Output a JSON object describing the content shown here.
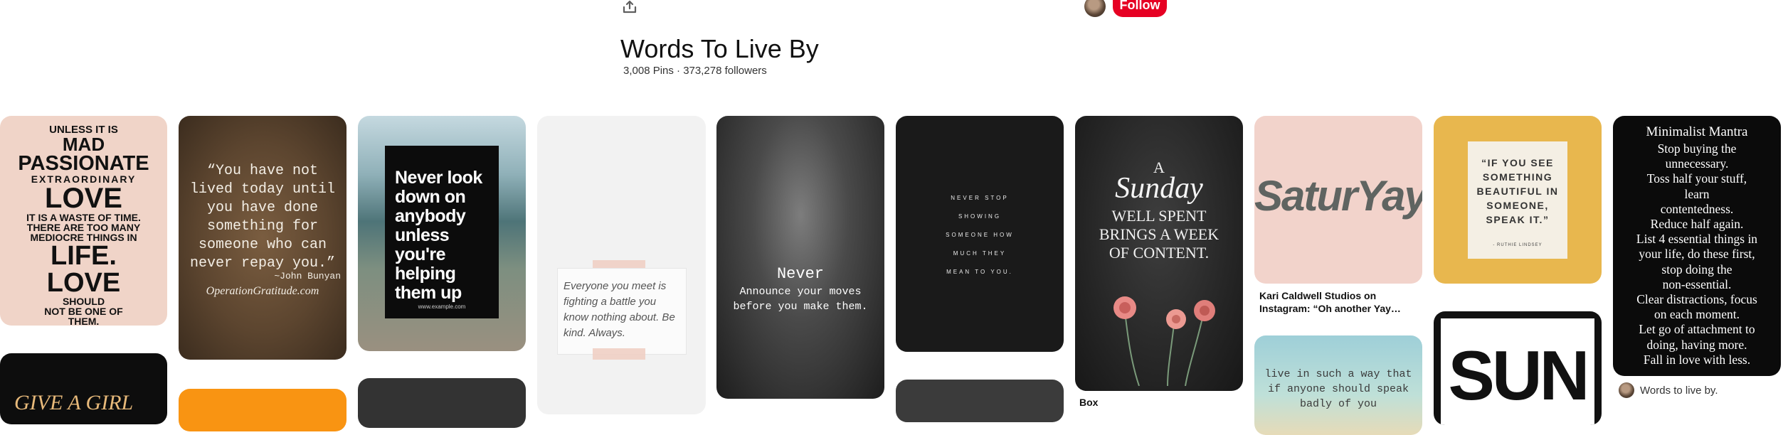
{
  "board": {
    "title": "Words To Live By",
    "stats": "3,008 Pins · 373,278 followers",
    "follow_label": "Follow"
  },
  "colors": {
    "brand": "#e60023"
  },
  "pins": {
    "p1": {
      "lines": [
        "UNLESS IT IS",
        "MAD",
        "PASSIONATE",
        "EXTRAORDINARY",
        "LOVE",
        "IT IS A WASTE OF TIME.",
        "THERE ARE TOO MANY",
        "MEDIOCRE THINGS IN",
        "LIFE.",
        "LOVE",
        "SHOULD",
        "NOT BE ONE OF",
        "THEM."
      ]
    },
    "p2": {
      "quote": "“You have not lived today until you have done something for someone who can never repay you.”",
      "author": "~John Bunyan",
      "site": "OperationGratitude.com"
    },
    "p3": {
      "quote": "Never look down on anybody unless you're helping them up",
      "site": "www.example.com"
    },
    "p4": {
      "note": "Everyone you meet is fighting a battle you know nothing about. Be kind. Always."
    },
    "p5": {
      "title": "Never",
      "sub": "Announce your moves before you make them."
    },
    "p6": {
      "lines": [
        "NEVER STOP",
        "SHOWING",
        "SOMEONE HOW",
        "MUCH THEY",
        "MEAN TO YOU."
      ]
    },
    "p7": {
      "a": "A",
      "sunday": "Sunday",
      "rest": "WELL SPENT BRINGS A WEEK OF CONTENT.",
      "caption": "Box"
    },
    "p8": {
      "art": "SaturYay",
      "caption": "Kari Caldwell Studios on Instagram: “Oh another Yay…"
    },
    "p9": {
      "quote": "“IF YOU SEE SOMETHING BEAUTIFUL IN SOMEONE, SPEAK IT.”",
      "author": "- RUTHIE LINDSEY"
    },
    "p10": {
      "heading": "Minimalist Mantra",
      "lines": [
        "Stop buying the",
        "unnecessary.",
        "Toss half your stuff,",
        "learn",
        "contentedness.",
        "Reduce half again.",
        "List 4 essential things in",
        "your life, do these first,",
        "stop doing the",
        "non-essential.",
        "Clear distractions, focus",
        "on each moment.",
        "Let go of attachment to",
        "doing, having more.",
        "Fall in love with less."
      ],
      "pinner": "Words to live by."
    },
    "p11": {
      "text": "live in such a way that if anyone should speak badly of you"
    },
    "p12": {
      "text": "SUN"
    },
    "p13": {
      "text": "GIVE A GIRL"
    }
  }
}
